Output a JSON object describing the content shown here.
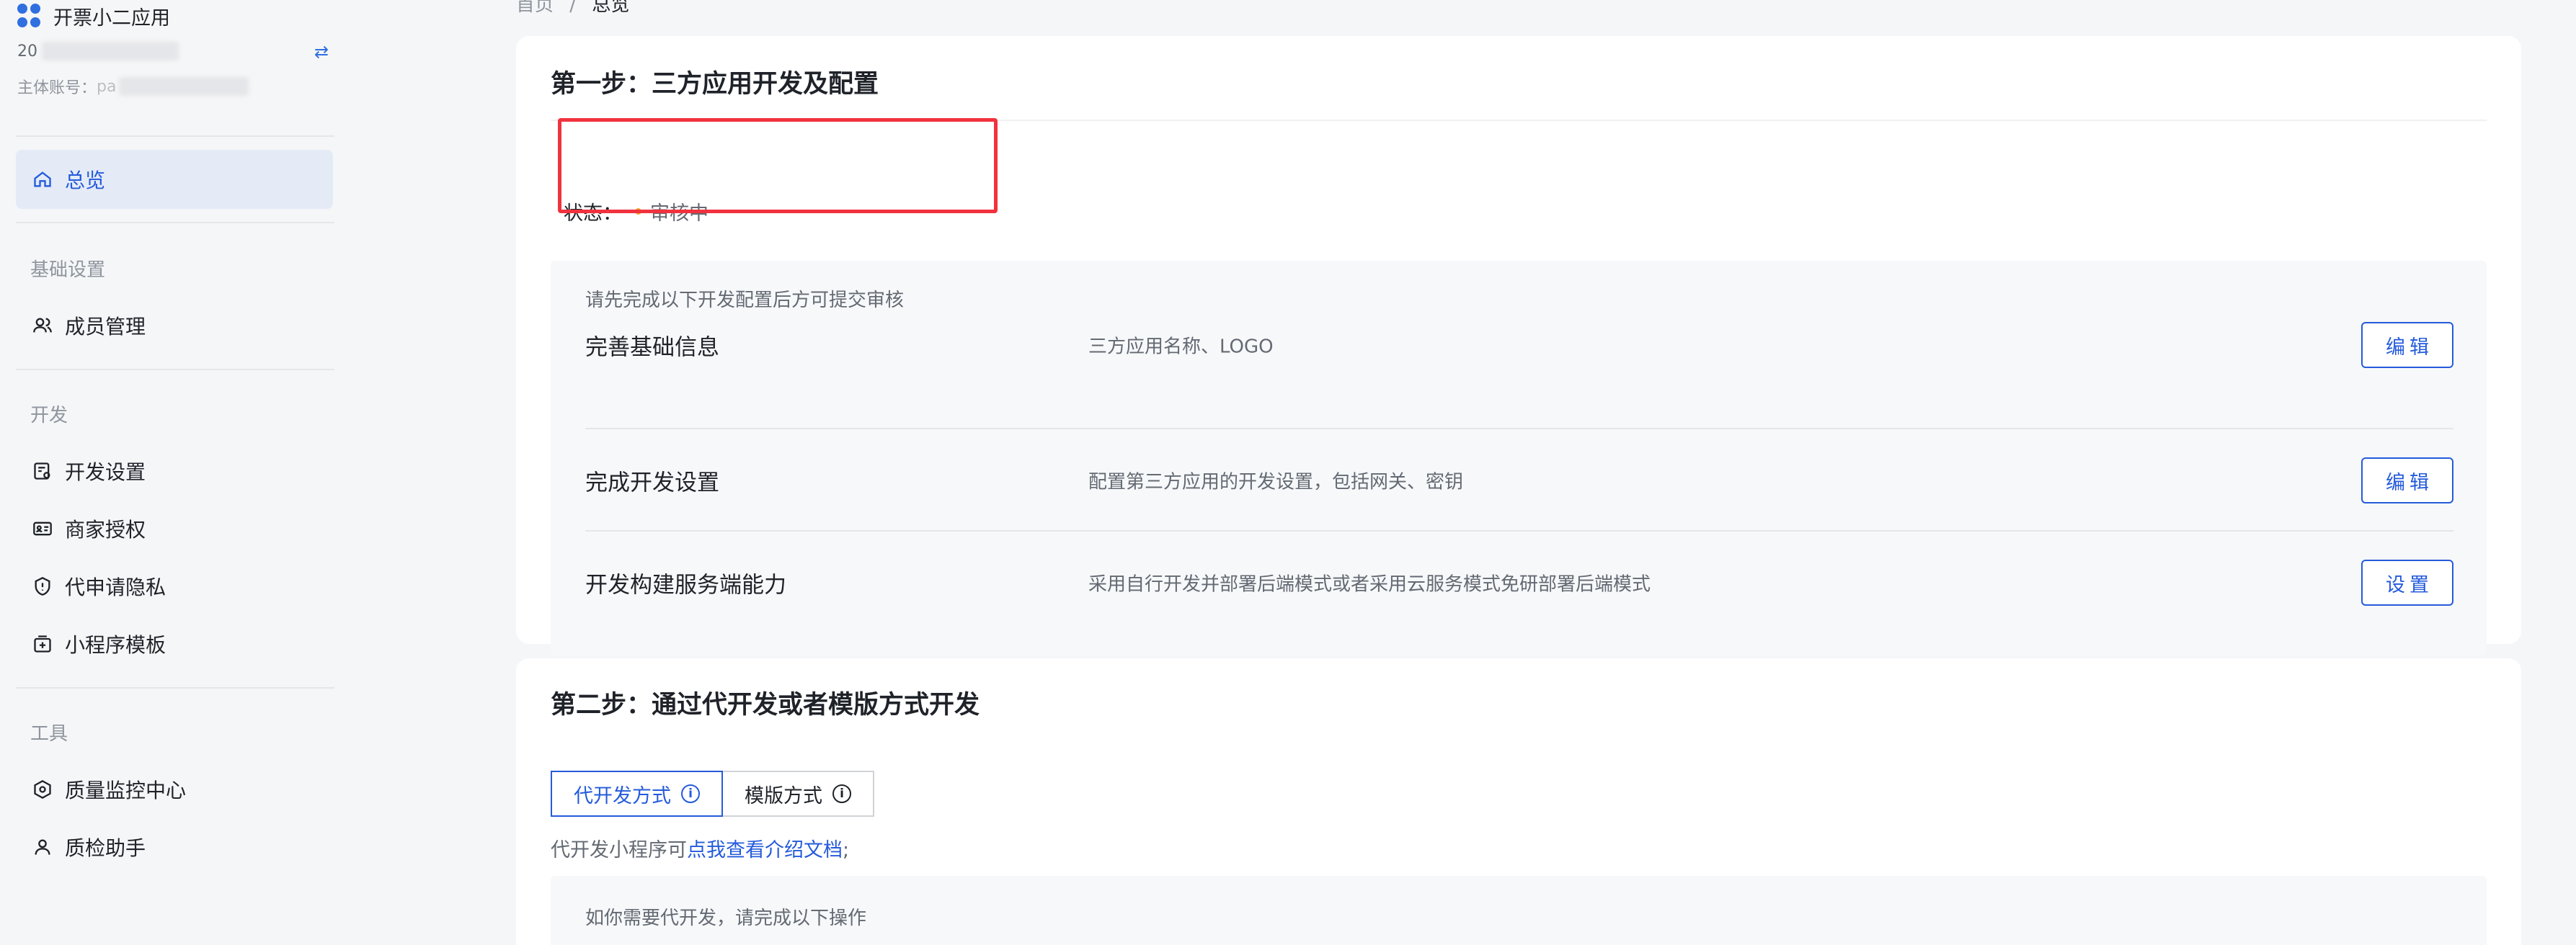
{
  "app": {
    "name": "开票小二应用",
    "account_id_prefix": "20",
    "subject_label": "主体账号：",
    "subject_prefix": "pa"
  },
  "sidebar": {
    "overview": "总览",
    "groups": [
      {
        "title": "基础设置",
        "items": [
          "成员管理"
        ]
      },
      {
        "title": "开发",
        "items": [
          "开发设置",
          "商家授权",
          "代申请隐私",
          "小程序模板"
        ]
      },
      {
        "title": "工具",
        "items": [
          "质量监控中心",
          "质检助手"
        ]
      }
    ]
  },
  "breadcrumb": {
    "home": "首页",
    "sep": "/",
    "current": "总览"
  },
  "step1": {
    "title": "第一步：三方应用开发及配置",
    "status_label": "状态：",
    "status_value": "审核中",
    "status_color": "#f5a623",
    "hint": "请先完成以下开发配置后方可提交审核",
    "rows": [
      {
        "title": "完善基础信息",
        "desc": "三方应用名称、LOGO",
        "button": "编辑"
      },
      {
        "title": "完成开发设置",
        "desc": "配置第三方应用的开发设置，包括网关、密钥",
        "button": "编辑"
      },
      {
        "title": "开发构建服务端能力",
        "desc": "采用自行开发并部署后端模式或者采用云服务模式免研部署后端模式",
        "button": "设置"
      }
    ]
  },
  "step2": {
    "title": "第二步：通过代开发或者模版方式开发",
    "tabs": [
      {
        "label": "代开发方式",
        "active": true
      },
      {
        "label": "模版方式",
        "active": false
      }
    ],
    "doc_prefix": "代开发小程序可",
    "doc_link": "点我查看介绍文档",
    "doc_suffix": ";",
    "panel_hint": "如你需要代开发，请完成以下操作"
  },
  "colors": {
    "accent": "#245bdb",
    "highlight_box": "#f1323e"
  }
}
